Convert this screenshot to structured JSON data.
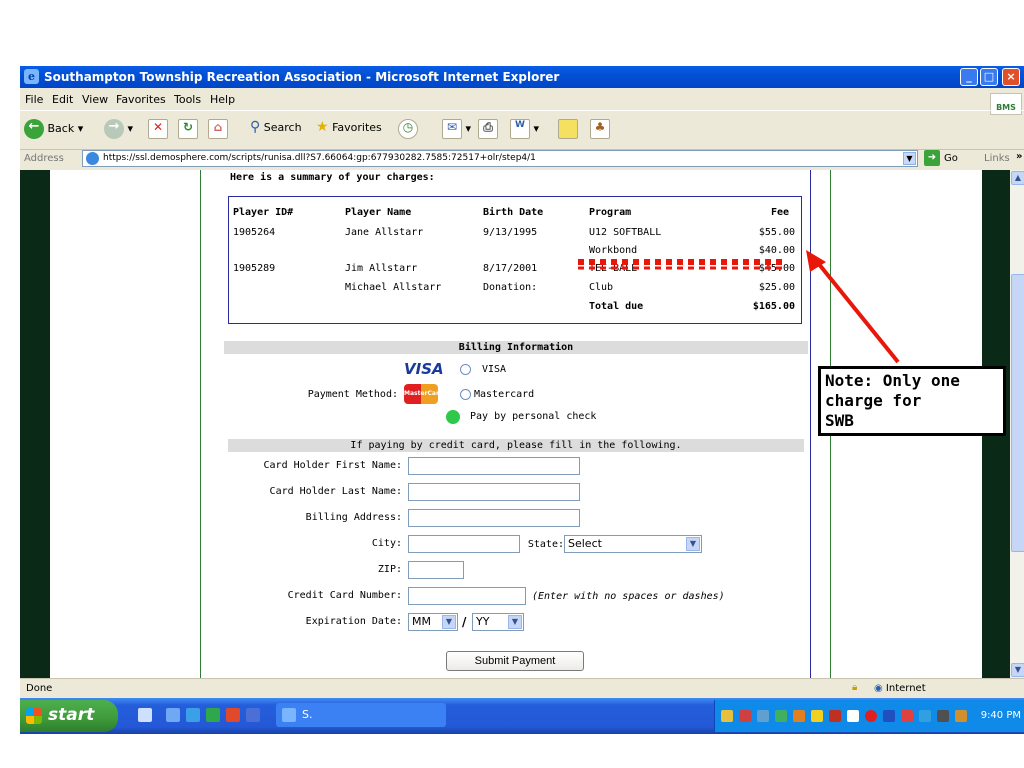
{
  "window": {
    "title": "Southampton Township Recreation Association - Microsoft Internet Explorer"
  },
  "menu": [
    "File",
    "Edit",
    "View",
    "Favorites",
    "Tools",
    "Help"
  ],
  "toolbar": {
    "back": "Back",
    "search": "Search",
    "favorites": "Favorites"
  },
  "address": {
    "label": "Address",
    "url": "https://ssl.demosphere.com/scripts/runisa.dll?S7.66064:gp:677930282.7585:72517+olr/step4/1",
    "go": "Go",
    "links": "Links"
  },
  "page": {
    "summary_heading": "Here is a summary of your charges:",
    "table": {
      "headers": [
        "Player ID#",
        "Player Name",
        "Birth Date",
        "Program",
        "Fee"
      ],
      "rows": [
        [
          "1905264",
          "Jane Allstarr",
          "9/13/1995",
          "U12 SOFTBALL",
          "$55.00"
        ],
        [
          "",
          "",
          "",
          "Workbond",
          "$40.00"
        ],
        [
          "1905289",
          "Jim Allstarr",
          "8/17/2001",
          "TEE-BALL",
          "$45.00"
        ],
        [
          "",
          "Michael Allstarr",
          "Donation:",
          "Club",
          "$25.00"
        ]
      ],
      "total_label": "Total due",
      "total_value": "$165.00"
    },
    "billing": {
      "heading": "Billing Information",
      "payment_method_label": "Payment Method:",
      "options": {
        "visa": "VISA",
        "mastercard": "Mastercard",
        "check": "Pay by personal check"
      },
      "visa_logo": "VISA",
      "mastercard_logo": "MasterCard",
      "cc_note": "If paying by credit card, please fill in the following.",
      "fields": {
        "first_name": "Card Holder First Name:",
        "last_name": "Card Holder Last Name:",
        "address": "Billing Address:",
        "city": "City:",
        "state": "State:",
        "state_value": "Select",
        "zip": "ZIP:",
        "cc_number": "Credit Card Number:",
        "cc_hint": "(Enter with no spaces or dashes)",
        "expiration": "Expiration Date:",
        "exp_month": "MM",
        "exp_sep": "/",
        "exp_year": "YY"
      },
      "submit": "Submit Payment"
    }
  },
  "annotation": {
    "lines": [
      "Note:  Only one",
      "charge for",
      "SWB"
    ],
    "color": "#e8170a"
  },
  "status": {
    "text": "Done",
    "zone": "Internet"
  },
  "taskbar": {
    "start": "start",
    "task": "S.",
    "clock": "9:40 PM"
  }
}
